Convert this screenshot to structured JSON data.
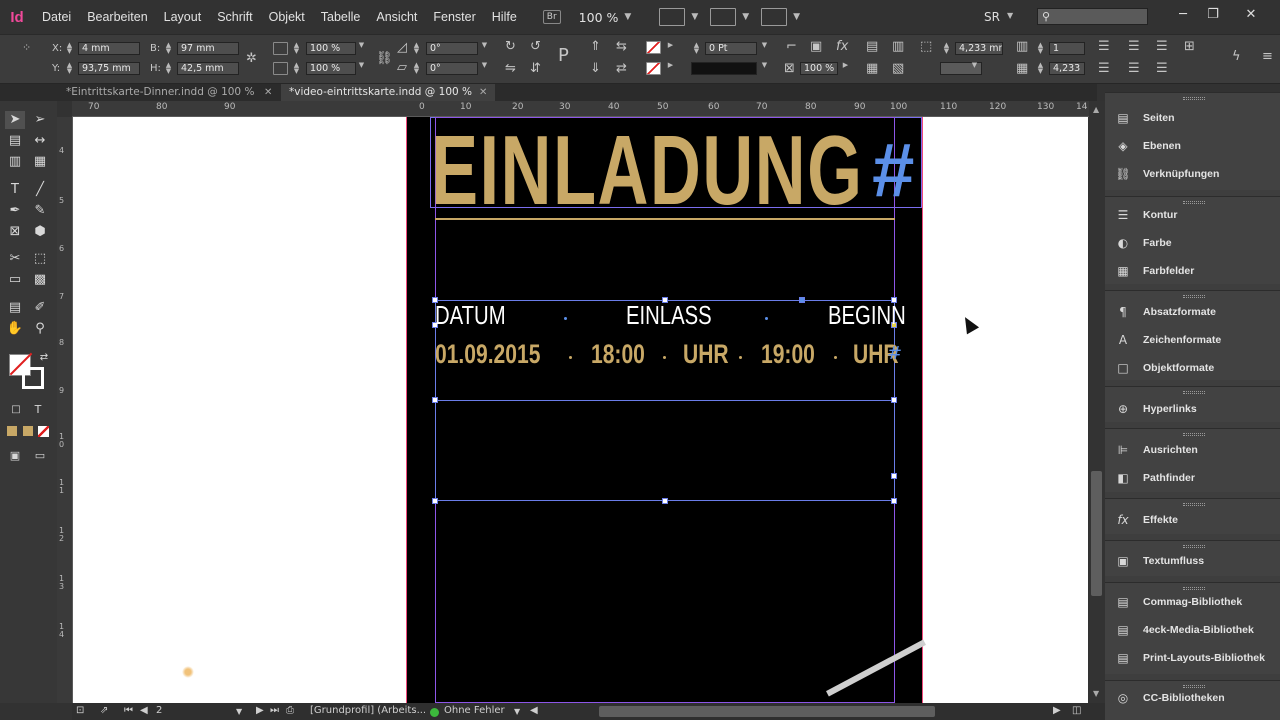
{
  "app": {
    "logo": "Id"
  },
  "menu": [
    "Datei",
    "Bearbeiten",
    "Layout",
    "Schrift",
    "Objekt",
    "Tabelle",
    "Ansicht",
    "Fenster",
    "Hilfe"
  ],
  "menubar": {
    "bridge_label": "Br",
    "zoom": "100 %",
    "workspace": "SR",
    "search_placeholder": ""
  },
  "window_controls": {
    "minimize": "─",
    "restore": "❐",
    "close": "✕"
  },
  "control": {
    "x_label": "X:",
    "x": "4 mm",
    "y_label": "Y:",
    "y": "93,75 mm",
    "w_label": "B:",
    "w": "97 mm",
    "h_label": "H:",
    "h": "42,5 mm",
    "scale_x": "100 %",
    "scale_y": "100 %",
    "rotate": "0°",
    "shear": "0°",
    "stroke_weight": "0 Pt",
    "opacity": "100 %",
    "spacing_a": "4,233 mm",
    "spacing_b": "4,233 m",
    "columns": "1",
    "glyph_fx": "fx",
    "glyph_p": "P"
  },
  "tabs": [
    {
      "label": "*Eintrittskarte-Dinner.indd @ 100 %",
      "active": false
    },
    {
      "label": "*video-eintrittskarte.indd @ 100 %",
      "active": true
    }
  ],
  "ruler_top": [
    "70",
    "80",
    "90",
    "0",
    "10",
    "20",
    "30",
    "40",
    "50",
    "60",
    "70",
    "80",
    "90",
    "100",
    "110",
    "120",
    "130",
    "14"
  ],
  "ruler_left": [
    "4",
    "5",
    "6",
    "7",
    "8",
    "9",
    "10",
    "11",
    "12",
    "13",
    "14"
  ],
  "document": {
    "headline": "EINLADUNG",
    "overset": "#",
    "labels": [
      "DATUM",
      "EINLASS",
      "BEGINN"
    ],
    "values": [
      "01.09.2015",
      "18:00",
      "UHR",
      "19:00",
      "UHR"
    ],
    "overset_small": "#"
  },
  "panels": [
    {
      "group": 1,
      "items": [
        {
          "label": "Seiten",
          "icon": "pages-icon",
          "glyph": "▤"
        },
        {
          "label": "Ebenen",
          "icon": "layers-icon",
          "glyph": "◈"
        },
        {
          "label": "Verknüpfungen",
          "icon": "links-icon",
          "glyph": "⛓"
        }
      ]
    },
    {
      "group": 2,
      "items": [
        {
          "label": "Kontur",
          "icon": "stroke-icon",
          "glyph": "☰"
        },
        {
          "label": "Farbe",
          "icon": "color-icon",
          "glyph": "◐"
        },
        {
          "label": "Farbfelder",
          "icon": "swatches-icon",
          "glyph": "▦"
        }
      ]
    },
    {
      "group": 3,
      "items": [
        {
          "label": "Absatzformate",
          "icon": "paragraph-styles-icon",
          "glyph": "¶"
        },
        {
          "label": "Zeichenformate",
          "icon": "character-styles-icon",
          "glyph": "A"
        },
        {
          "label": "Objektformate",
          "icon": "object-styles-icon",
          "glyph": "□"
        }
      ]
    },
    {
      "group": 4,
      "items": [
        {
          "label": "Hyperlinks",
          "icon": "hyperlinks-icon",
          "glyph": "⊕"
        }
      ]
    },
    {
      "group": 5,
      "items": [
        {
          "label": "Ausrichten",
          "icon": "align-icon",
          "glyph": "⊫"
        },
        {
          "label": "Pathfinder",
          "icon": "pathfinder-icon",
          "glyph": "◧"
        }
      ]
    },
    {
      "group": 6,
      "items": [
        {
          "label": "Effekte",
          "icon": "effects-icon",
          "glyph": "fx"
        }
      ]
    },
    {
      "group": 7,
      "items": [
        {
          "label": "Textumfluss",
          "icon": "text-wrap-icon",
          "glyph": "▣"
        }
      ]
    },
    {
      "group": 8,
      "items": [
        {
          "label": "Commag-Bibliothek",
          "icon": "library-icon",
          "glyph": "▤"
        },
        {
          "label": "4eck-Media-Bibliothek",
          "icon": "library-icon",
          "glyph": "▤"
        },
        {
          "label": "Print-Layouts-Bibliothek",
          "icon": "library-icon",
          "glyph": "▤"
        }
      ]
    },
    {
      "group": 9,
      "items": [
        {
          "label": "CC-Bibliotheken",
          "icon": "cc-libraries-icon",
          "glyph": "◎"
        }
      ]
    }
  ],
  "status": {
    "page": "2",
    "profile": "[Grundprofil] (Arbeits...",
    "preflight": "Ohne Fehler"
  },
  "colors": {
    "accent_gold": "#c8a866",
    "frame_blue": "#7b6ef0",
    "overset_blue": "#5b8fe8",
    "bleed": "#f04a7c",
    "preflight_ok": "#3cba3c"
  }
}
